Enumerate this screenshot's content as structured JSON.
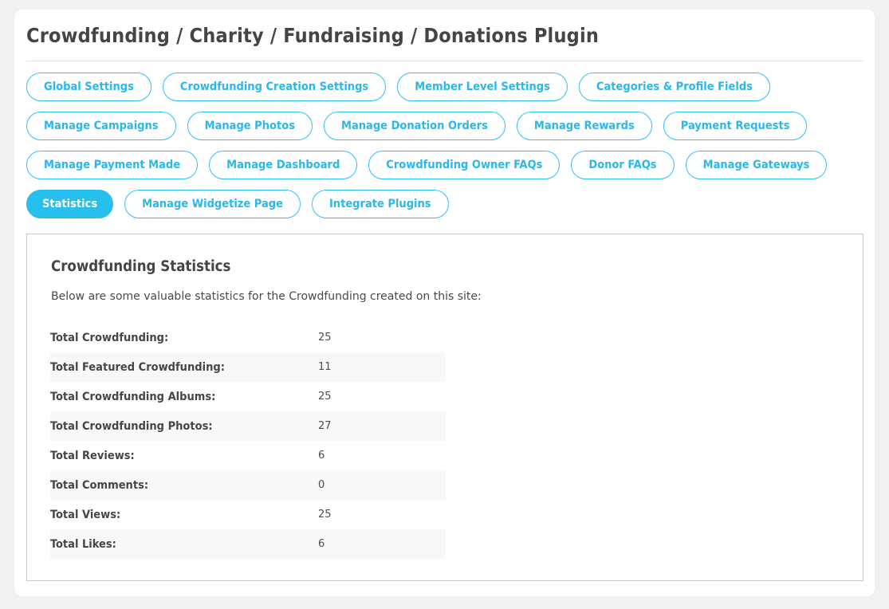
{
  "header": {
    "title": "Crowdfunding / Charity / Fundraising / Donations Plugin"
  },
  "tabs": {
    "rows": [
      [
        {
          "label": "Global Settings",
          "active": false
        },
        {
          "label": "Crowdfunding Creation Settings",
          "active": false
        },
        {
          "label": "Member Level Settings",
          "active": false
        },
        {
          "label": "Categories & Profile Fields",
          "active": false
        }
      ],
      [
        {
          "label": "Manage Campaigns",
          "active": false
        },
        {
          "label": "Manage Photos",
          "active": false
        },
        {
          "label": "Manage Donation Orders",
          "active": false
        },
        {
          "label": "Manage Rewards",
          "active": false
        },
        {
          "label": "Payment Requests",
          "active": false
        }
      ],
      [
        {
          "label": "Manage Payment Made",
          "active": false
        },
        {
          "label": "Manage Dashboard",
          "active": false
        },
        {
          "label": "Crowdfunding Owner FAQs",
          "active": false
        },
        {
          "label": "Donor FAQs",
          "active": false
        },
        {
          "label": "Manage Gateways",
          "active": false
        }
      ],
      [
        {
          "label": "Statistics",
          "active": true
        },
        {
          "label": "Manage Widgetize Page",
          "active": false
        },
        {
          "label": "Integrate Plugins",
          "active": false
        }
      ]
    ]
  },
  "statistics": {
    "heading": "Crowdfunding Statistics",
    "description": "Below are some valuable statistics for the Crowdfunding created on this site:",
    "rows": [
      {
        "label": "Total Crowdfunding:",
        "value": "25"
      },
      {
        "label": "Total Featured Crowdfunding:",
        "value": "11"
      },
      {
        "label": "Total Crowdfunding Albums:",
        "value": "25"
      },
      {
        "label": "Total Crowdfunding Photos:",
        "value": "27"
      },
      {
        "label": "Total Reviews:",
        "value": "6"
      },
      {
        "label": "Total Comments:",
        "value": "0"
      },
      {
        "label": "Total Views:",
        "value": "25"
      },
      {
        "label": "Total Likes:",
        "value": "6"
      }
    ]
  },
  "colors": {
    "accent": "#27c0ee",
    "page_background": "#f1f1f1",
    "card_background": "#ffffff",
    "stripe": "#f8f8f8",
    "text_dark": "#454545",
    "border_gray": "#c9c9c9"
  }
}
